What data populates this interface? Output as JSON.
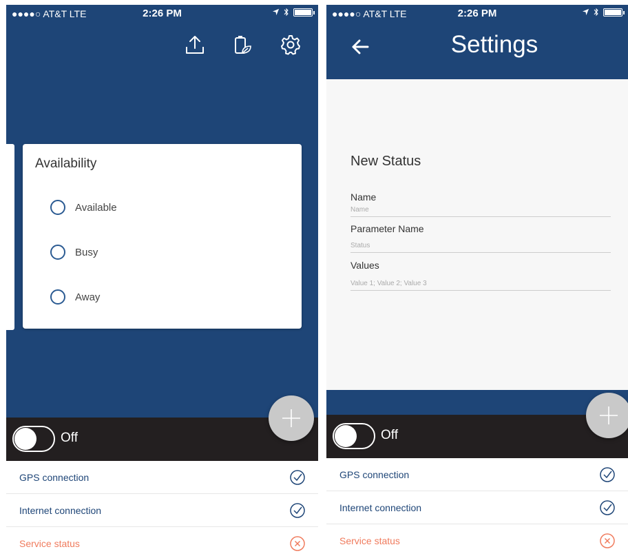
{
  "status_bar": {
    "carrier": "●●●●○ AT&T  LTE",
    "time": "2:26 PM"
  },
  "left_screen": {
    "top_icons": [
      "upload-icon",
      "battery-leaf-icon",
      "gear-icon"
    ],
    "card": {
      "title": "Availability",
      "options": [
        {
          "label": "Available"
        },
        {
          "label": "Busy"
        },
        {
          "label": "Away"
        }
      ]
    }
  },
  "right_screen": {
    "header": {
      "title": "Settings"
    },
    "form": {
      "title": "New Status",
      "fields": [
        {
          "label": "Name",
          "placeholder": "Name"
        },
        {
          "label": "Parameter Name",
          "placeholder": "Status"
        },
        {
          "label": "Values",
          "placeholder": "Value 1; Value 2; Value 3"
        }
      ]
    }
  },
  "switch": {
    "label": "Off",
    "state": "off"
  },
  "status_items": [
    {
      "label": "GPS connection",
      "state": "ok"
    },
    {
      "label": "Internet connection",
      "state": "ok"
    },
    {
      "label": "Service status",
      "state": "error"
    }
  ],
  "colors": {
    "primary": "#1e4577",
    "link_text": "#1e4577",
    "error": "#f07b5d",
    "dark_bar": "#231f20",
    "fab": "#c9c9c9"
  }
}
